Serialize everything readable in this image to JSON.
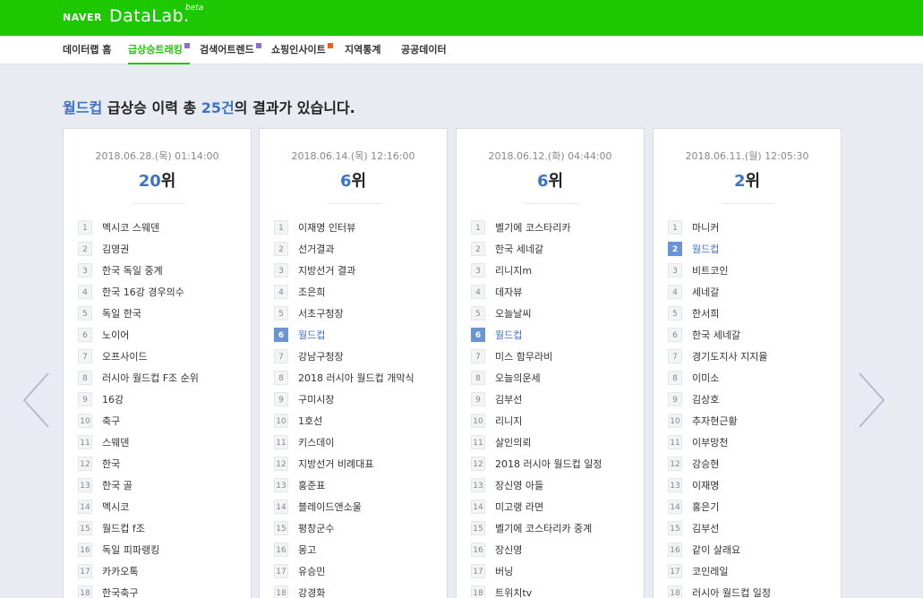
{
  "header": {
    "brand": "NAVER",
    "product": "DataLab.",
    "beta": "beta"
  },
  "nav": [
    {
      "label": "데이터랩 홈",
      "badge": ""
    },
    {
      "label": "급상승트래킹",
      "badge": "new"
    },
    {
      "label": "검색어트렌드",
      "badge": "new"
    },
    {
      "label": "쇼핑인사이트",
      "badge": "hot"
    },
    {
      "label": "지역통계",
      "badge": ""
    },
    {
      "label": "공공데이터",
      "badge": ""
    }
  ],
  "headline": {
    "keyword": "월드컵",
    "text1": " 급상승 이력 총 ",
    "count": "25건",
    "text2": "의 결과가 있습니다."
  },
  "icons": {
    "prev": "chevron-left-icon",
    "next": "chevron-right-icon"
  },
  "colors": {
    "brand": "#1ec800",
    "highlight": "#3c74c7",
    "highlight_badge": "#6a94d4"
  },
  "cards": [
    {
      "date": "2018.06.28.(목) 01:14:00",
      "rank_num": "20",
      "rank_unit": "위",
      "items": [
        {
          "num": "1",
          "text": "멕시코 스웨덴"
        },
        {
          "num": "2",
          "text": "김영권"
        },
        {
          "num": "3",
          "text": "한국 독일 중계"
        },
        {
          "num": "4",
          "text": "한국 16강 경우의수"
        },
        {
          "num": "5",
          "text": "독일 한국"
        },
        {
          "num": "6",
          "text": "노이어"
        },
        {
          "num": "7",
          "text": "오프사이드"
        },
        {
          "num": "8",
          "text": "러시아 월드컵 F조 순위"
        },
        {
          "num": "9",
          "text": "16강"
        },
        {
          "num": "10",
          "text": "축구"
        },
        {
          "num": "11",
          "text": "스웨덴"
        },
        {
          "num": "12",
          "text": "한국"
        },
        {
          "num": "13",
          "text": "한국 골"
        },
        {
          "num": "14",
          "text": "멕시코"
        },
        {
          "num": "15",
          "text": "월드컵 f조"
        },
        {
          "num": "16",
          "text": "독일 피파랭킹"
        },
        {
          "num": "17",
          "text": "카카오톡"
        },
        {
          "num": "18",
          "text": "한국축구"
        }
      ]
    },
    {
      "date": "2018.06.14.(목) 12:16:00",
      "rank_num": "6",
      "rank_unit": "위",
      "items": [
        {
          "num": "1",
          "text": "이재명 인터뷰"
        },
        {
          "num": "2",
          "text": "선거결과"
        },
        {
          "num": "3",
          "text": "지방선거 결과"
        },
        {
          "num": "4",
          "text": "조은희"
        },
        {
          "num": "5",
          "text": "서초구청장"
        },
        {
          "num": "6",
          "text": "월드컵",
          "highlight": true
        },
        {
          "num": "7",
          "text": "강남구청장"
        },
        {
          "num": "8",
          "text": "2018 러시아 월드컵 개막식"
        },
        {
          "num": "9",
          "text": "구미시장"
        },
        {
          "num": "10",
          "text": "1호선"
        },
        {
          "num": "11",
          "text": "키스데이"
        },
        {
          "num": "12",
          "text": "지방선거 비례대표"
        },
        {
          "num": "13",
          "text": "홍준표"
        },
        {
          "num": "14",
          "text": "블레이드앤소울"
        },
        {
          "num": "15",
          "text": "평창군수"
        },
        {
          "num": "16",
          "text": "몽고"
        },
        {
          "num": "17",
          "text": "유승민"
        },
        {
          "num": "18",
          "text": "강경화"
        }
      ]
    },
    {
      "date": "2018.06.12.(화) 04:44:00",
      "rank_num": "6",
      "rank_unit": "위",
      "items": [
        {
          "num": "1",
          "text": "벨기에 코스타리카"
        },
        {
          "num": "2",
          "text": "한국 세네갈"
        },
        {
          "num": "3",
          "text": "리니지m"
        },
        {
          "num": "4",
          "text": "데자뷰"
        },
        {
          "num": "5",
          "text": "오늘날씨"
        },
        {
          "num": "6",
          "text": "월드컵",
          "highlight": true
        },
        {
          "num": "7",
          "text": "미스 함무라비"
        },
        {
          "num": "8",
          "text": "오늘의운세"
        },
        {
          "num": "9",
          "text": "김부선"
        },
        {
          "num": "10",
          "text": "리니지"
        },
        {
          "num": "11",
          "text": "살인의뢰"
        },
        {
          "num": "12",
          "text": "2018 러시아 월드컵 일정"
        },
        {
          "num": "13",
          "text": "장신영 아들"
        },
        {
          "num": "14",
          "text": "미고랭 라면"
        },
        {
          "num": "15",
          "text": "벨기에 코스타리카 중계"
        },
        {
          "num": "16",
          "text": "장신영"
        },
        {
          "num": "17",
          "text": "버닝"
        },
        {
          "num": "18",
          "text": "트위치tv"
        }
      ]
    },
    {
      "date": "2018.06.11.(월) 12:05:30",
      "rank_num": "2",
      "rank_unit": "위",
      "items": [
        {
          "num": "1",
          "text": "마니커"
        },
        {
          "num": "2",
          "text": "월드컵",
          "highlight": true
        },
        {
          "num": "3",
          "text": "비트코인"
        },
        {
          "num": "4",
          "text": "세네갈"
        },
        {
          "num": "5",
          "text": "한서희"
        },
        {
          "num": "6",
          "text": "한국 세네갈"
        },
        {
          "num": "7",
          "text": "경기도지사 지지율"
        },
        {
          "num": "8",
          "text": "이미소"
        },
        {
          "num": "9",
          "text": "김상호"
        },
        {
          "num": "10",
          "text": "추자현근황"
        },
        {
          "num": "11",
          "text": "이부망천"
        },
        {
          "num": "12",
          "text": "강승현"
        },
        {
          "num": "13",
          "text": "이재명"
        },
        {
          "num": "14",
          "text": "홍은기"
        },
        {
          "num": "15",
          "text": "김부선"
        },
        {
          "num": "16",
          "text": "같이 살래요"
        },
        {
          "num": "17",
          "text": "코인레일"
        },
        {
          "num": "18",
          "text": "러시아 월드컵 일정"
        }
      ]
    }
  ]
}
